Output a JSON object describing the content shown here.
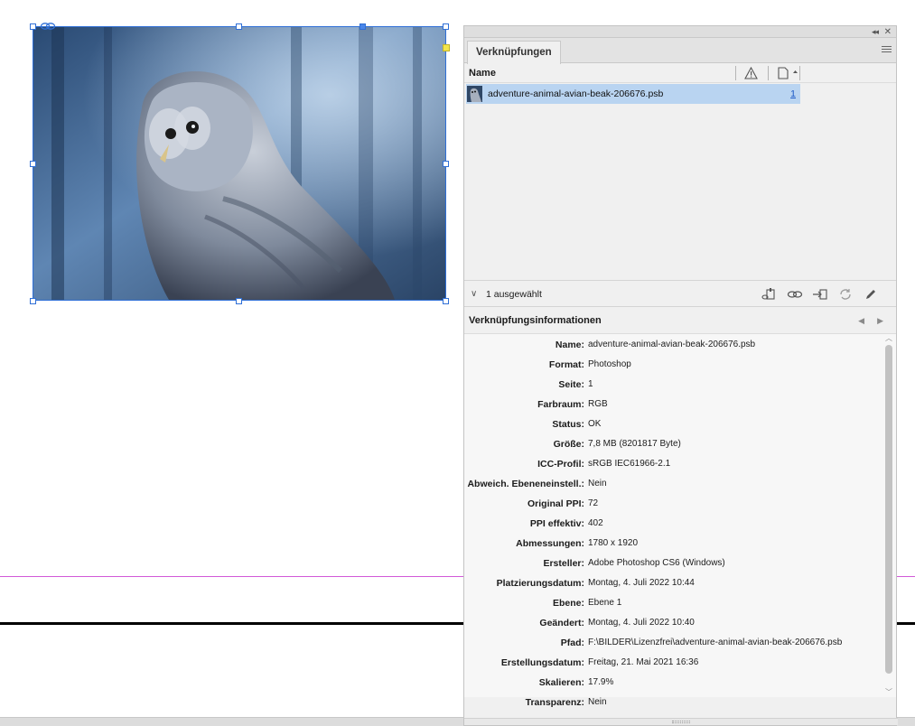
{
  "canvas": {
    "guide_color": "#d25ad8",
    "frame_color": "#2f6fd6",
    "image_subject": "owl-photo"
  },
  "panel": {
    "tab_label": "Verknüpfungen",
    "column_name_label": "Name",
    "links": [
      {
        "name": "adventure-animal-avian-beak-206676.psb",
        "page": "1"
      }
    ],
    "selection_text": "1 ausgewählt",
    "info_title": "Verknüpfungsinformationen",
    "selection_color": "#b9d4f1",
    "info": [
      {
        "label": "Name:",
        "value": "adventure-animal-avian-beak-206676.psb"
      },
      {
        "label": "Format:",
        "value": "Photoshop"
      },
      {
        "label": "Seite:",
        "value": "1"
      },
      {
        "label": "Farbraum:",
        "value": "RGB"
      },
      {
        "label": "Status:",
        "value": "OK"
      },
      {
        "label": "Größe:",
        "value": "7,8 MB (8201817 Byte)"
      },
      {
        "label": "ICC-Profil:",
        "value": "sRGB IEC61966-2.1"
      },
      {
        "label": "Abweich. Ebeneneinstell.:",
        "value": "Nein"
      },
      {
        "label": "Original PPI:",
        "value": "72"
      },
      {
        "label": "PPI effektiv:",
        "value": "402"
      },
      {
        "label": "Abmessungen:",
        "value": "1780 x 1920"
      },
      {
        "label": "Ersteller:",
        "value": "Adobe Photoshop CS6 (Windows)"
      },
      {
        "label": "Platzierungsdatum:",
        "value": "Montag, 4. Juli 2022 10:44"
      },
      {
        "label": "Ebene:",
        "value": "Ebene 1"
      },
      {
        "label": "Geändert:",
        "value": "Montag, 4. Juli 2022 10:40"
      },
      {
        "label": "Pfad:",
        "value": "F:\\BILDER\\Lizenzfrei\\adventure-animal-avian-beak-206676.psb"
      },
      {
        "label": "Erstellungsdatum:",
        "value": "Freitag, 21. Mai 2021 16:36"
      },
      {
        "label": "Skalieren:",
        "value": "17.9%"
      },
      {
        "label": "Transparenz:",
        "value": "Nein"
      }
    ]
  }
}
